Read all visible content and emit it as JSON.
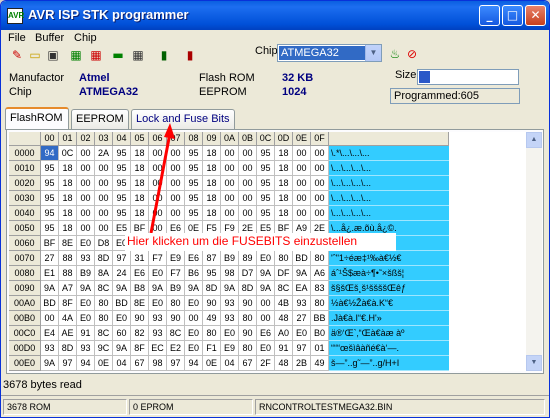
{
  "window": {
    "title": "AVR ISP STK programmer",
    "minimize_glyph": "_",
    "maximize_glyph": "□",
    "close_glyph": "✕"
  },
  "menu": [
    "File",
    "Buffer",
    "Chip"
  ],
  "toolbar": {
    "icons": [
      "erase-icon",
      "open-icon",
      "save-icon",
      "read-icon",
      "write-icon",
      "verify-icon",
      "blank-check-icon",
      "lock-icon",
      "device-icon"
    ],
    "chip_label": "Chip",
    "chip_value": "ATMEGA32",
    "chip_icons": [
      "power-icon",
      "stop-icon"
    ]
  },
  "info": {
    "manufactor_label": "Manufactor",
    "manufactor_value": "Atmel",
    "chip_label": "Chip",
    "chip_value": "ATMEGA32",
    "flash_label": "Flash ROM",
    "flash_value": "32 KB",
    "eeprom_label": "EEPROM",
    "eeprom_value": "1024",
    "size_label": "Size",
    "size_fraction": 0.11,
    "programmed_text": "Programmed:605"
  },
  "tabs": [
    "FlashROM",
    "EEPROM",
    "Lock and Fuse Bits"
  ],
  "active_tab": 0,
  "grid": {
    "col_headers": [
      "00",
      "01",
      "02",
      "03",
      "04",
      "05",
      "06",
      "07",
      "08",
      "09",
      "0A",
      "0B",
      "0C",
      "0D",
      "0E",
      "0F"
    ],
    "rows": [
      {
        "addr": "0000",
        "bytes": [
          "94",
          "0C",
          "00",
          "2A",
          "95",
          "18",
          "00",
          "00",
          "95",
          "18",
          "00",
          "00",
          "95",
          "18",
          "00",
          "00"
        ],
        "ascii": "\\.*\\...\\...\\..."
      },
      {
        "addr": "0010",
        "bytes": [
          "95",
          "18",
          "00",
          "00",
          "95",
          "18",
          "00",
          "00",
          "95",
          "18",
          "00",
          "00",
          "95",
          "18",
          "00",
          "00"
        ],
        "ascii": "\\...\\...\\...\\..."
      },
      {
        "addr": "0020",
        "bytes": [
          "95",
          "18",
          "00",
          "00",
          "95",
          "18",
          "00",
          "00",
          "95",
          "18",
          "00",
          "00",
          "95",
          "18",
          "00",
          "00"
        ],
        "ascii": "\\...\\...\\...\\..."
      },
      {
        "addr": "0030",
        "bytes": [
          "95",
          "18",
          "00",
          "00",
          "95",
          "18",
          "00",
          "00",
          "95",
          "18",
          "00",
          "00",
          "95",
          "18",
          "00",
          "00"
        ],
        "ascii": "\\...\\...\\...\\..."
      },
      {
        "addr": "0040",
        "bytes": [
          "95",
          "18",
          "00",
          "00",
          "95",
          "18",
          "00",
          "00",
          "95",
          "18",
          "00",
          "00",
          "95",
          "18",
          "00",
          "00"
        ],
        "ascii": "\\...\\...\\...\\..."
      },
      {
        "addr": "0050",
        "bytes": [
          "95",
          "18",
          "00",
          "00",
          "E5",
          "BF",
          "00",
          "E6",
          "0E",
          "F5",
          "F9",
          "2E",
          "E5",
          "BF",
          "A9",
          "2E"
        ],
        "ascii": "\\...å¿.æ.õù.å¿©."
      },
      {
        "addr": "0060",
        "bytes": [
          "BF",
          "8E",
          "E0",
          "D8",
          "E0",
          "",
          "",
          "",
          "",
          "",
          "",
          "",
          "",
          "",
          "",
          ""
        ],
        "ascii": ""
      },
      {
        "addr": "0070",
        "bytes": [
          "27",
          "88",
          "93",
          "8D",
          "97",
          "31",
          "F7",
          "E9",
          "E6",
          "87",
          "B9",
          "89",
          "E0",
          "80",
          "BD",
          "80"
        ],
        "ascii": "'ˆ\"1÷éæ‡¹‰à€½€"
      },
      {
        "addr": "0080",
        "bytes": [
          "E1",
          "88",
          "B9",
          "8A",
          "24",
          "E6",
          "E0",
          "F7",
          "B6",
          "95",
          "98",
          "D7",
          "9A",
          "DF",
          "9A",
          "A6"
        ],
        "ascii": "áˆ¹Š$æà÷¶•˜×šßš¦"
      },
      {
        "addr": "0090",
        "bytes": [
          "9A",
          "A7",
          "9A",
          "8C",
          "9A",
          "B8",
          "9A",
          "B9",
          "9A",
          "8D",
          "9A",
          "8D",
          "9A",
          "8C",
          "EA",
          "83"
        ],
        "ascii": "š§šŒš¸š¹ššššŒêƒ"
      },
      {
        "addr": "00A0",
        "bytes": [
          "BD",
          "8F",
          "E0",
          "80",
          "BD",
          "8E",
          "E0",
          "80",
          "E0",
          "90",
          "93",
          "90",
          "00",
          "4B",
          "93",
          "80"
        ],
        "ascii": "½à€½Žà€à.K“€"
      },
      {
        "addr": "00B0",
        "bytes": [
          "00",
          "4A",
          "E0",
          "80",
          "E0",
          "90",
          "93",
          "90",
          "00",
          "49",
          "93",
          "80",
          "00",
          "48",
          "27",
          "BB"
        ],
        "ascii": ".Jà€à.I“€.H'»"
      },
      {
        "addr": "00C0",
        "bytes": [
          "E4",
          "AE",
          "91",
          "8C",
          "60",
          "82",
          "93",
          "8C",
          "E0",
          "80",
          "E0",
          "90",
          "E6",
          "A0",
          "E0",
          "B0"
        ],
        "ascii": "ä®‘Œ`‚“Œà€àæ àº"
      },
      {
        "addr": "00D0",
        "bytes": [
          "93",
          "8D",
          "93",
          "9C",
          "9A",
          "8F",
          "EC",
          "E2",
          "E0",
          "F1",
          "E9",
          "80",
          "E0",
          "91",
          "97",
          "01"
        ],
        "ascii": "“““œšìâàñé€à‘—."
      },
      {
        "addr": "00E0",
        "bytes": [
          "9A",
          "97",
          "94",
          "0E",
          "04",
          "67",
          "98",
          "97",
          "94",
          "0E",
          "04",
          "67",
          "2F",
          "48",
          "2B",
          "49"
        ],
        "ascii": "š—”..g˜—”..g/H+I"
      }
    ]
  },
  "annotation": "Hier klicken um die FUSEBITS einzustellen",
  "status": "3678 bytes read",
  "bottom": [
    "3678 ROM",
    "0 EPROM",
    "RNCONTROLTESTMEGA32.BIN"
  ]
}
